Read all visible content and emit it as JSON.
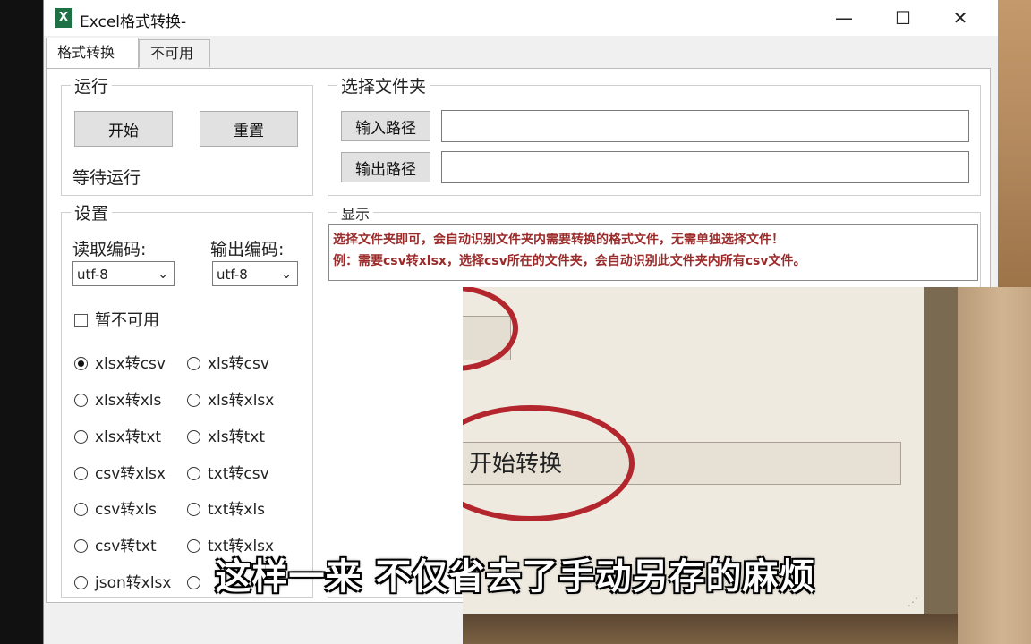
{
  "window": {
    "title": "Excel格式转换-",
    "app_icon": "X",
    "controls": [
      "—",
      "☐",
      "✕"
    ]
  },
  "tabs": [
    {
      "label": "格式转换",
      "active": true
    },
    {
      "label": "不可用",
      "active": false
    }
  ],
  "run_group": {
    "legend": "运行",
    "start_label": "开始",
    "reset_label": "重置",
    "status": "等待运行"
  },
  "folder_group": {
    "legend": "选择文件夹",
    "input_path_label": "输入路径",
    "output_path_label": "输出路径",
    "input_value": "",
    "output_value": ""
  },
  "settings": {
    "legend": "设置",
    "read_encoding_label": "读取编码:",
    "output_encoding_label": "输出编码:",
    "read_encoding": "utf-8",
    "output_encoding": "utf-8",
    "checkbox_label": "暂不可用",
    "options": [
      {
        "label": "xlsx转csv",
        "checked": true
      },
      {
        "label": "xls转csv",
        "checked": false
      },
      {
        "label": "xlsx转xls",
        "checked": false
      },
      {
        "label": "xls转xlsx",
        "checked": false
      },
      {
        "label": "xlsx转txt",
        "checked": false
      },
      {
        "label": "xls转txt",
        "checked": false
      },
      {
        "label": "csv转xlsx",
        "checked": false
      },
      {
        "label": "txt转csv",
        "checked": false
      },
      {
        "label": "csv转xls",
        "checked": false
      },
      {
        "label": "txt转xls",
        "checked": false
      },
      {
        "label": "csv转txt",
        "checked": false
      },
      {
        "label": "txt转xlsx",
        "checked": false
      },
      {
        "label": "json转xlsx",
        "checked": false
      },
      {
        "label": "",
        "checked": false
      }
    ]
  },
  "display": {
    "legend": "显示",
    "line1": "选择文件夹即可，会自动识别文件夹内需要转换的格式文件，无需单独选择文件！",
    "line2": "例：需要csv转xlsx，选择csv所在的文件夹，会自动识别此文件夹内所有csv文件。"
  },
  "overlay": {
    "start_convert_label": "开始转换",
    "accent": "#b3262d"
  },
  "subtitle": "这样一来 不仅省去了手动另存的麻烦"
}
